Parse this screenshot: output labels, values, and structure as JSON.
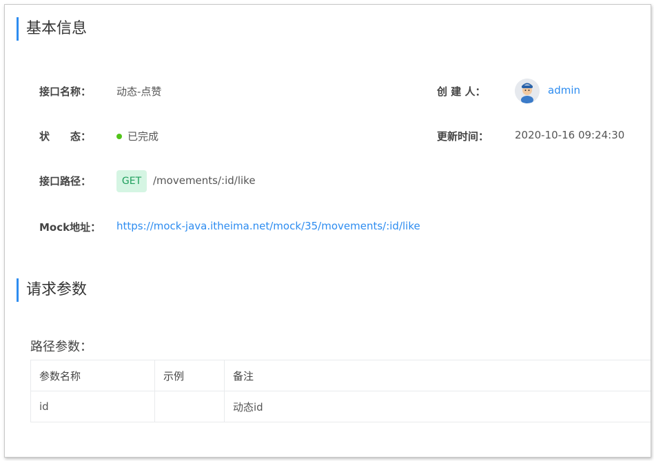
{
  "sections": {
    "basic_title": "基本信息",
    "request_title": "请求参数"
  },
  "basic": {
    "name_label": "接口名称：",
    "name_value": "动态-点赞",
    "status_label": "状　　态：",
    "status_value": "已完成",
    "status_color": "#52c41a",
    "path_label": "接口路径：",
    "method": "GET",
    "path_value": "/movements/:id/like",
    "mock_label": "Mock地址：",
    "mock_value": "https://mock-java.itheima.net/mock/35/movements/:id/like",
    "creator_label": "创 建 人：",
    "creator_value": "admin",
    "updated_label": "更新时间：",
    "updated_value": "2020-10-16 09:24:30"
  },
  "params": {
    "subtitle": "路径参数：",
    "headers": [
      "参数名称",
      "示例",
      "备注"
    ],
    "rows": [
      [
        "id",
        "",
        "动态id"
      ]
    ]
  },
  "colors": {
    "accent": "#2d8cf0",
    "tag_bg": "#d5f5e3",
    "tag_text": "#1e9e5c"
  }
}
